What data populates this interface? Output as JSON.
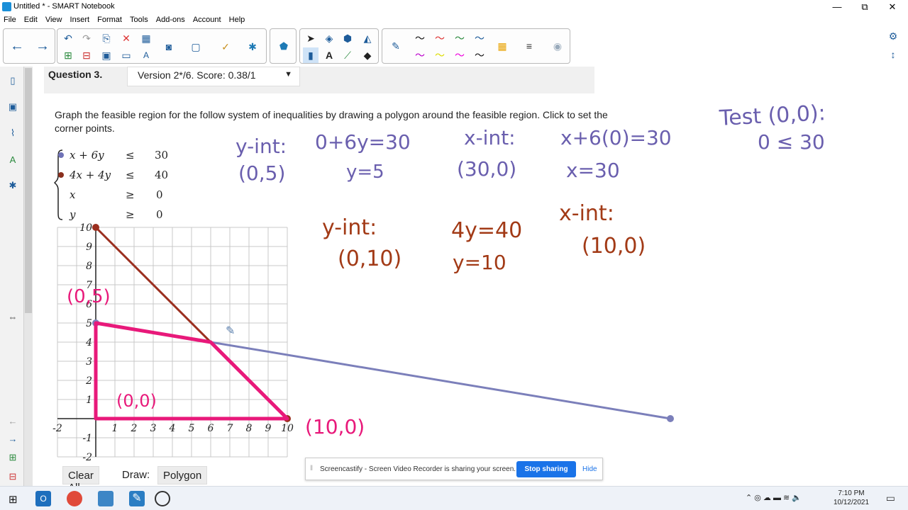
{
  "window": {
    "title": "Untitled * - SMART Notebook",
    "minimize": "—",
    "maximize": "⧉",
    "close": "✕"
  },
  "menu": [
    "File",
    "Edit",
    "View",
    "Insert",
    "Format",
    "Tools",
    "Add-ons",
    "Account",
    "Help"
  ],
  "question": {
    "title": "Question 3.",
    "version": "Version 2*/6. Score: 0.38/1",
    "prompt": "Graph the feasible region for the follow system of inequalities by drawing a polygon around the feasible region. Click to set the corner points.",
    "inequalities": [
      {
        "lhs": "x + 6y",
        "op": "≤",
        "rhs": "30"
      },
      {
        "lhs": "4x + 4y",
        "op": "≤",
        "rhs": "40"
      },
      {
        "lhs": "x",
        "op": "≥",
        "rhs": "0"
      },
      {
        "lhs": "y",
        "op": "≥",
        "rhs": "0"
      }
    ]
  },
  "chart_data": {
    "type": "line",
    "x_ticks": [
      "-2",
      "1",
      "2",
      "3",
      "4",
      "5",
      "6",
      "7",
      "8",
      "9",
      "10"
    ],
    "y_ticks": [
      "10",
      "9",
      "8",
      "7",
      "6",
      "5",
      "4",
      "3",
      "2",
      "1",
      "-1",
      "-2"
    ],
    "xlim": [
      -2,
      10
    ],
    "ylim": [
      -2,
      10
    ],
    "grid": true,
    "series": [
      {
        "points": [
          [
            0,
            10
          ],
          [
            10,
            0
          ]
        ],
        "color": "#9b2f1f"
      },
      {
        "points": [
          [
            0,
            5
          ],
          [
            30,
            0
          ]
        ],
        "color": "#7b7fba"
      },
      {
        "points": [
          [
            0,
            5
          ],
          [
            0,
            0
          ],
          [
            10,
            0
          ],
          [
            6,
            4
          ]
        ],
        "color": "#e8197a"
      }
    ]
  },
  "handwriting": {
    "test": [
      "Test (0,0):",
      "0 ≤ 30"
    ],
    "line1": [
      "y-int:",
      "(0,5)",
      "0+6y=30",
      "y=5",
      "x-int:",
      "(30,0)",
      "x+6(0)=30",
      "x=30"
    ],
    "line2": [
      "y-int:",
      "(0,10)",
      "4y=40",
      "y=10",
      "x-int:",
      "(10,0)"
    ],
    "graph_labels": [
      "(0,5)",
      "(0,0)",
      "(10,0)"
    ],
    "color_blue": "#6a5fae",
    "color_red": "#a23a16",
    "color_pink": "#e8197a"
  },
  "bottom": {
    "clear_all": "Clear All",
    "draw_label": "Draw:",
    "polygon": "Polygon"
  },
  "share": {
    "message": "Screencastify - Screen Video Recorder is sharing your screen.",
    "stop": "Stop sharing",
    "hide": "Hide"
  },
  "taskbar": {
    "time": "7:10 PM",
    "date": "10/12/2021"
  }
}
